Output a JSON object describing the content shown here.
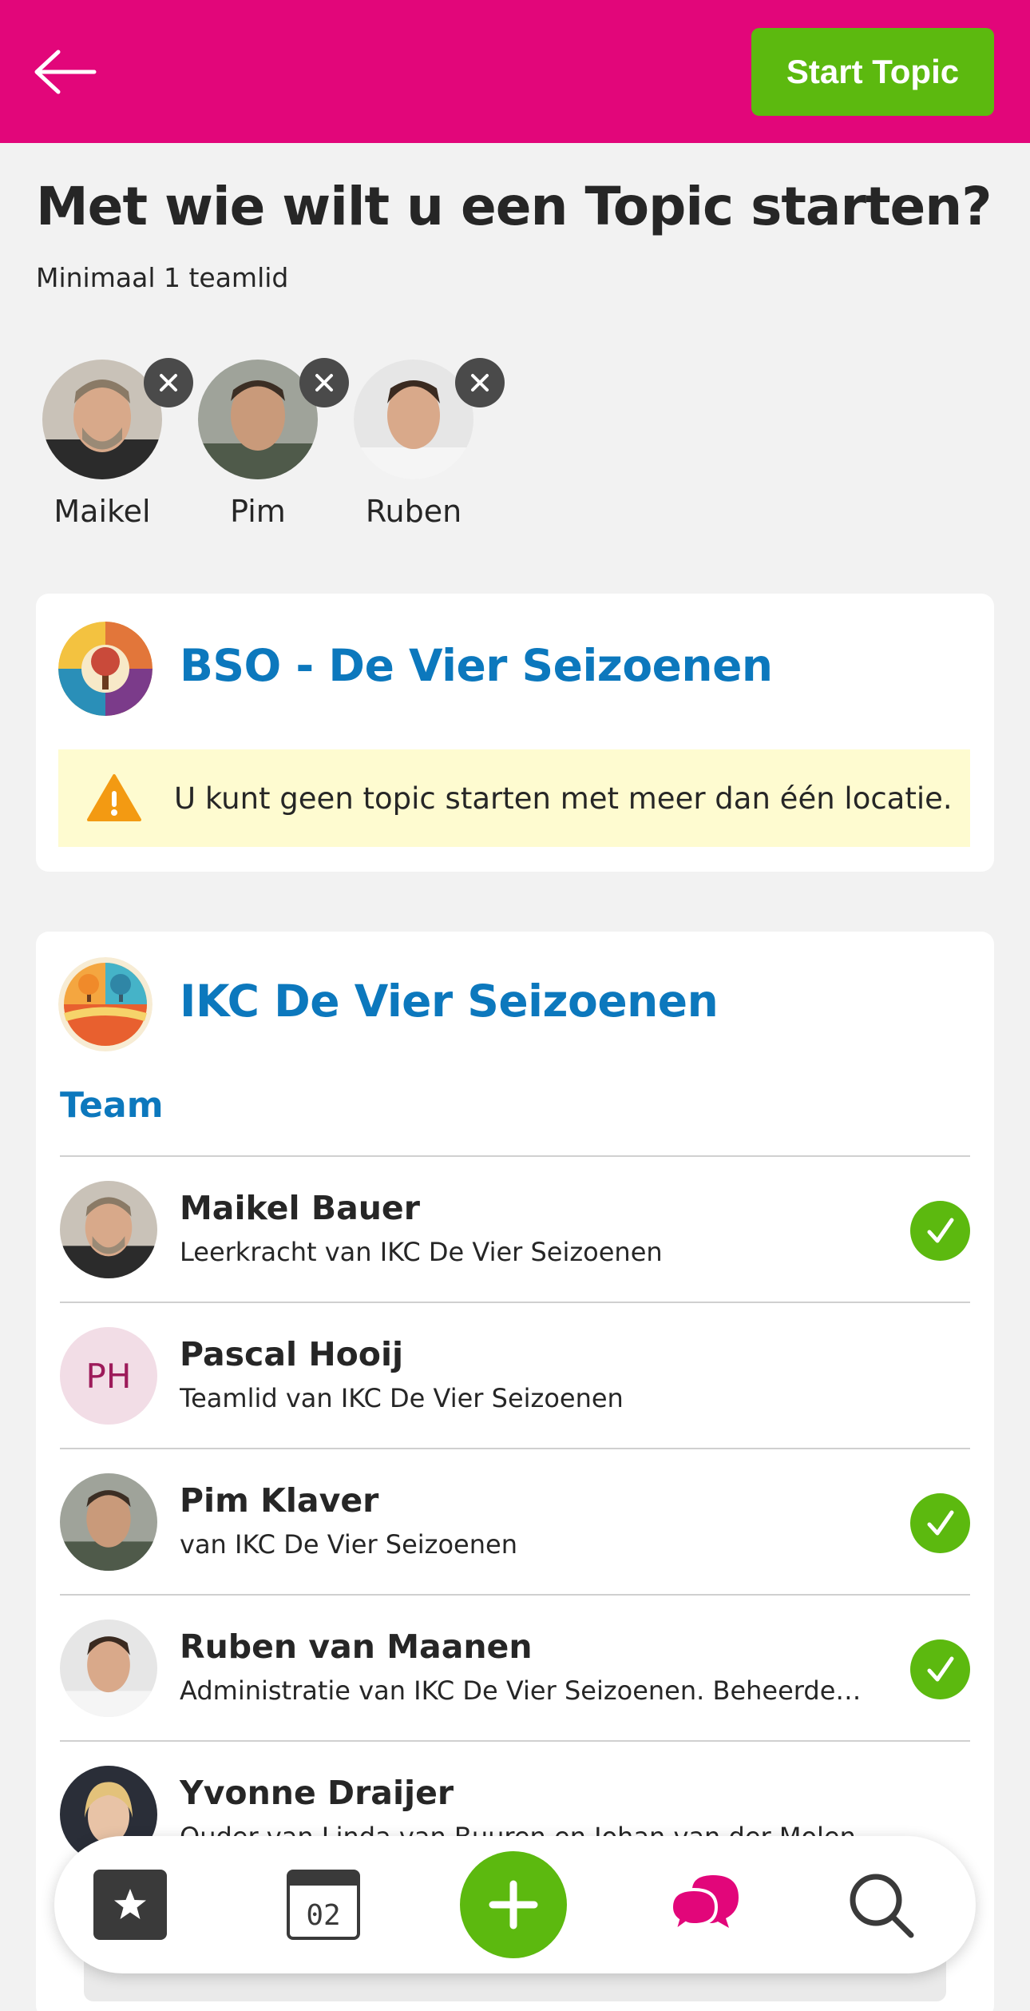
{
  "header": {
    "start_label": "Start Topic",
    "colors": {
      "brand": "#e2067a",
      "action": "#5cb90f"
    }
  },
  "page": {
    "title": "Met wie wilt u een Topic starten?",
    "subtitle": "Minimaal 1 teamlid"
  },
  "selected": [
    {
      "name": "Maikel"
    },
    {
      "name": "Pim"
    },
    {
      "name": "Ruben"
    }
  ],
  "locations": [
    {
      "title": "BSO - De Vier Seizoenen",
      "warning": "U kunt geen topic starten met meer dan één locatie."
    },
    {
      "title": "IKC De Vier Seizoenen",
      "section_label": "Team",
      "members": [
        {
          "name": "Maikel Bauer",
          "role": "Leerkracht van IKC De Vier Seizoenen",
          "selected": true
        },
        {
          "name": "Pascal Hooij",
          "initials": "PH",
          "role": "Teamlid van IKC De Vier Seizoenen",
          "selected": false
        },
        {
          "name": "Pim Klaver",
          "role": "van IKC De Vier Seizoenen",
          "selected": true
        },
        {
          "name": "Ruben van Maanen",
          "role": "Administratie van IKC De Vier Seizoenen. Beheerder v...",
          "selected": true
        },
        {
          "name": "Yvonne Draijer",
          "role": "Ouder van Linda van Buuren en Johan van der Molen",
          "selected": false
        }
      ]
    }
  ],
  "tabbar": {
    "calendar_day": "02",
    "icons": [
      "star-icon",
      "calendar-icon",
      "plus-icon",
      "chat-icon",
      "search-icon"
    ]
  }
}
